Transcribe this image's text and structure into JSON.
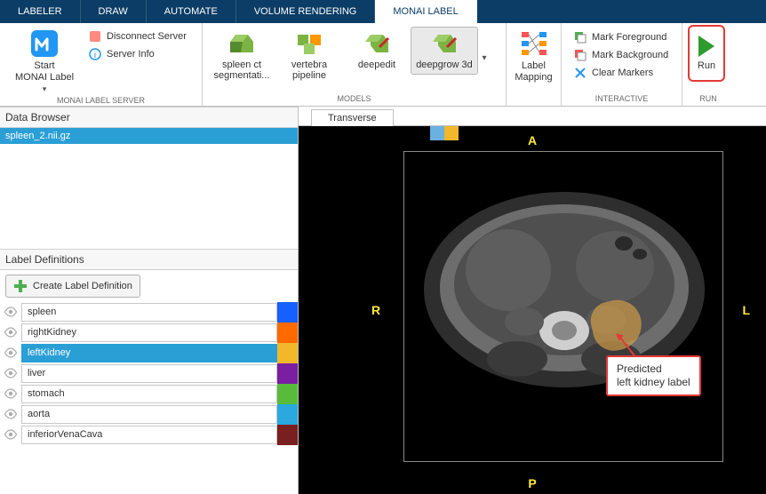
{
  "menu": {
    "tabs": [
      "LABELER",
      "DRAW",
      "AUTOMATE",
      "VOLUME RENDERING",
      "MONAI LABEL"
    ],
    "active_index": 4
  },
  "ribbon": {
    "server": {
      "start": "Start\nMONAI Label",
      "disconnect": "Disconnect Server",
      "info": "Server Info",
      "group_label": "MONAI LABEL SERVER"
    },
    "models": {
      "items": [
        {
          "label": "spleen ct segmentati..."
        },
        {
          "label": "vertebra pipeline"
        },
        {
          "label": "deepedit"
        },
        {
          "label": "deepgrow 3d"
        }
      ],
      "active_index": 3,
      "group_label": "MODELS"
    },
    "mapping": {
      "label": "Label Mapping"
    },
    "interactive": {
      "items": [
        "Mark Foreground",
        "Mark Background",
        "Clear Markers"
      ],
      "group_label": "INTERACTIVE"
    },
    "run": {
      "label": "Run",
      "group_label": "RUN"
    }
  },
  "data_browser": {
    "title": "Data Browser",
    "files": [
      "spleen_2.nii.gz"
    ]
  },
  "label_definitions": {
    "title": "Label Definitions",
    "create": "Create Label Definition",
    "labels": [
      {
        "name": "spleen",
        "color": "#1560ff"
      },
      {
        "name": "rightKidney",
        "color": "#ff6a00"
      },
      {
        "name": "leftKidney",
        "color": "#f2b72a"
      },
      {
        "name": "liver",
        "color": "#7a1fa2"
      },
      {
        "name": "stomach",
        "color": "#58bb3a"
      },
      {
        "name": "aorta",
        "color": "#2aa8e0"
      },
      {
        "name": "inferiorVenaCava",
        "color": "#7a1f1f"
      }
    ],
    "selected_index": 2
  },
  "viewer": {
    "tab": "Transverse",
    "orientation": {
      "a": "A",
      "p": "P",
      "l": "L",
      "r": "R"
    },
    "callout": "Predicted\nleft kidney label"
  }
}
